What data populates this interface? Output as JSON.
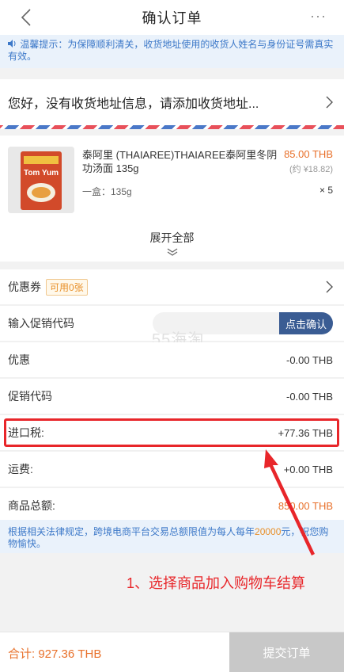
{
  "header": {
    "title": "确认订单",
    "more": "···"
  },
  "notice": {
    "text": "温馨提示：为保障顺利清关，收货地址使用的收货人姓名与身份证号需真实有效。"
  },
  "address": {
    "prompt": "您好，没有收货地址信息，请添加收货地址..."
  },
  "product": {
    "name": "泰阿里 (THAIAREE)THAIAREE泰阿里冬阴功汤面 135g",
    "price": "85.00 THB",
    "price_cny": "(约 ¥18.82)",
    "spec": "一盒：135g",
    "qty": "× 5",
    "thumb_label": "Tom Yum"
  },
  "expand": {
    "label": "展开全部"
  },
  "coupon": {
    "label": "优惠券",
    "badge": "可用0张"
  },
  "promo": {
    "label": "输入促销代码",
    "placeholder": "",
    "button": "点击确认"
  },
  "watermark": "55海淘",
  "fees": [
    {
      "label": "优惠",
      "value": "-0.00 THB"
    },
    {
      "label": "促销代码",
      "value": "-0.00 THB"
    },
    {
      "label": "进口税:",
      "value": "+77.36 THB"
    },
    {
      "label": "运费:",
      "value": "+0.00 THB"
    },
    {
      "label": "商品总额:",
      "value": "850.00 THB"
    }
  ],
  "legal": {
    "before": "根据相关法律规定，跨境电商平台交易总额限值为每人每年",
    "amount": "20000",
    "after": "元，祝您购物愉快。"
  },
  "annotation": {
    "text": "1、选择商品加入购物车结算"
  },
  "footer": {
    "total": "合计: 927.36 THB",
    "submit": "提交订单"
  },
  "colors": {
    "accent": "#e8702a",
    "notice_blue": "#3c78c8",
    "button_blue": "#3a5c93",
    "annotation_red": "#e8262a"
  }
}
